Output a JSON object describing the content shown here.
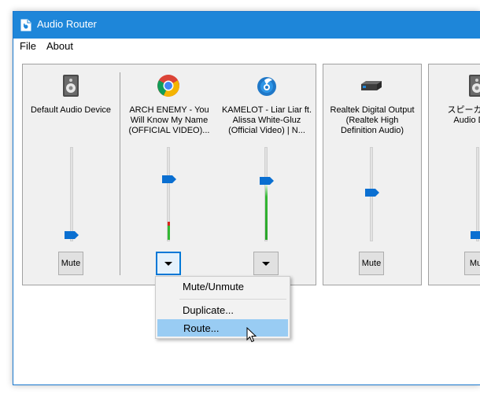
{
  "window": {
    "title": "Audio Router"
  },
  "menu": [
    "File",
    "About"
  ],
  "devices": [
    {
      "name": "Default Audio Device",
      "icon": "speaker-icon",
      "button": "Mute",
      "volume": 0.1
    },
    {
      "name": "ARCH ENEMY - You Will Know My Name (OFFICIAL VIDEO)...",
      "icon": "chrome-icon",
      "volume": 0.6
    },
    {
      "name": "KAMELOT - Liar Liar ft. Alissa White-Gluz (Official Video) | N...",
      "icon": "app-icon",
      "volume": 0.6
    },
    {
      "name": "Realtek Digital Output (Realtek High Definition Audio)",
      "icon": "audio-device-icon",
      "button": "Mute",
      "volume": 0.5
    },
    {
      "name": "スピーカー Audio D",
      "icon": "speaker-icon",
      "button": "Mut",
      "volume": 0.1
    }
  ],
  "context_menu": {
    "items": [
      "Mute/Unmute",
      "Duplicate...",
      "Route..."
    ],
    "highlighted": "Route..."
  },
  "colors": {
    "accent": "#0a6fd1",
    "titlebar": "#1e86d9",
    "meter": "#33b833"
  }
}
